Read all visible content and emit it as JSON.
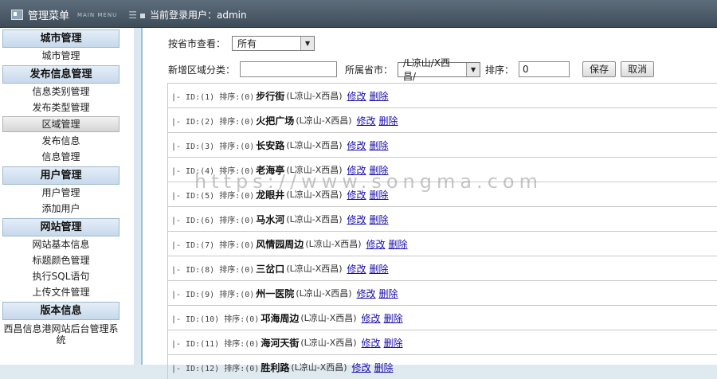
{
  "header": {
    "menu_title": "管理菜单",
    "menu_subtitle": "MAIN MENU",
    "current_user": "当前登录用户：admin"
  },
  "sidebar": {
    "sections": [
      {
        "title": "城市管理",
        "items": [
          "城市管理"
        ]
      },
      {
        "title": "发布信息管理",
        "items": [
          "信息类别管理",
          "发布类型管理",
          "区域管理",
          "发布信息",
          "信息管理"
        ]
      },
      {
        "title": "用户管理",
        "items": [
          "用户管理",
          "添加用户"
        ]
      },
      {
        "title": "网站管理",
        "items": [
          "网站基本信息",
          "标题颜色管理",
          "执行SQL语句",
          "上传文件管理"
        ]
      },
      {
        "title": "版本信息",
        "items": []
      }
    ],
    "active_item": "区域管理",
    "footer": "西昌信息港网站后台管理系统"
  },
  "filter": {
    "label": "按省市查看：",
    "value": "所有"
  },
  "add_form": {
    "category_label": "新增区域分类：",
    "category_value": "",
    "province_label": "所属省市：",
    "province_value": "/L凉山/X西昌/",
    "sort_label": "排序：",
    "sort_value": "0",
    "save_label": "保存",
    "cancel_label": "取消"
  },
  "rows": [
    {
      "pre": "|- ID:(1) 排序:(0)",
      "name": "步行街",
      "city": "(L凉山-X西昌)"
    },
    {
      "pre": "|- ID:(2) 排序:(0)",
      "name": "火把广场",
      "city": "(L凉山-X西昌)"
    },
    {
      "pre": "|- ID:(3) 排序:(0)",
      "name": "长安路",
      "city": "(L凉山-X西昌)"
    },
    {
      "pre": "|- ID:(4) 排序:(0)",
      "name": "老海亭",
      "city": "(L凉山-X西昌)"
    },
    {
      "pre": "|- ID:(5) 排序:(0)",
      "name": "龙眼井",
      "city": "(L凉山-X西昌)"
    },
    {
      "pre": "|- ID:(6) 排序:(0)",
      "name": "马水河",
      "city": "(L凉山-X西昌)"
    },
    {
      "pre": "|- ID:(7) 排序:(0)",
      "name": "风情园周边",
      "city": "(L凉山-X西昌)"
    },
    {
      "pre": "|- ID:(8) 排序:(0)",
      "name": "三岔口",
      "city": "(L凉山-X西昌)"
    },
    {
      "pre": "|- ID:(9) 排序:(0)",
      "name": "州一医院",
      "city": "(L凉山-X西昌)"
    },
    {
      "pre": "|- ID:(10) 排序:(0)",
      "name": "邛海周边",
      "city": "(L凉山-X西昌)"
    },
    {
      "pre": "|- ID:(11) 排序:(0)",
      "name": "海河天街",
      "city": "(L凉山-X西昌)"
    },
    {
      "pre": "|- ID:(12) 排序:(0)",
      "name": "胜利路",
      "city": "(L凉山-X西昌)"
    }
  ],
  "row_actions": {
    "edit": "修改",
    "delete": "删除"
  },
  "watermark": "https://www.songma.com"
}
